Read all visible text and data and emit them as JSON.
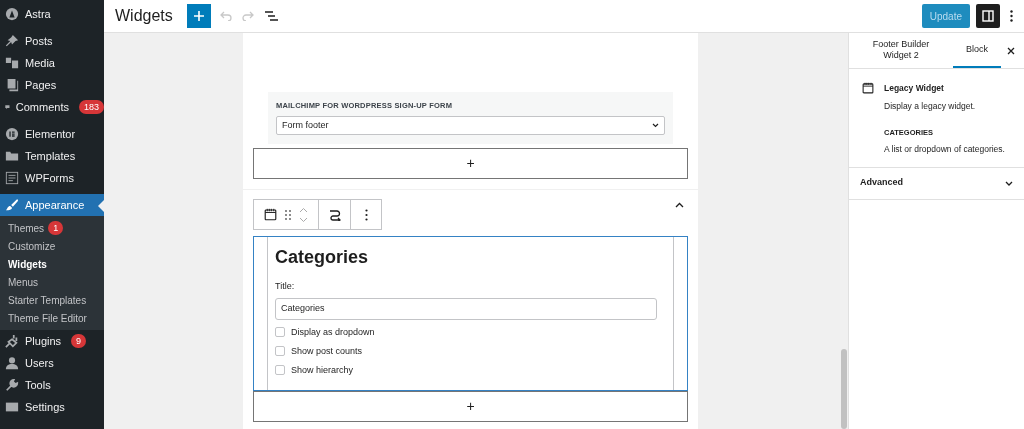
{
  "sidebar": {
    "items": [
      {
        "kind": "menu",
        "label": "Astra",
        "selected": false
      },
      {
        "kind": "gap"
      },
      {
        "kind": "menu",
        "label": "Posts",
        "selected": false
      },
      {
        "kind": "menu",
        "label": "Media",
        "selected": false
      },
      {
        "kind": "menu",
        "label": "Pages",
        "selected": false
      },
      {
        "kind": "menu",
        "label": "Comments",
        "badge": "183",
        "selected": false
      },
      {
        "kind": "gap"
      },
      {
        "kind": "menu",
        "label": "Elementor",
        "selected": false
      },
      {
        "kind": "menu",
        "label": "Templates",
        "selected": false
      },
      {
        "kind": "menu",
        "label": "WPForms",
        "selected": false
      },
      {
        "kind": "gap"
      },
      {
        "kind": "menu",
        "label": "Appearance",
        "selected": true,
        "children": [
          {
            "label": "Themes",
            "badge": "1",
            "selected": false
          },
          {
            "label": "Customize",
            "selected": false
          },
          {
            "label": "Widgets",
            "selected": true
          },
          {
            "label": "Menus",
            "selected": false
          },
          {
            "label": "Starter Templates",
            "selected": false
          },
          {
            "label": "Theme File Editor",
            "selected": false
          }
        ]
      },
      {
        "kind": "menu",
        "label": "Plugins",
        "badge": "9",
        "selected": false
      },
      {
        "kind": "menu",
        "label": "Users",
        "selected": false
      },
      {
        "kind": "menu",
        "label": "Tools",
        "selected": false
      },
      {
        "kind": "menu",
        "label": "Settings",
        "selected": false
      }
    ]
  },
  "header": {
    "title": "Widgets",
    "update_button": "Update",
    "undo_disabled": true,
    "redo_disabled": true
  },
  "canvas": {
    "mailchimp": {
      "label": "MAILCHIMP FOR WORDPRESS SIGN-UP FORM",
      "value": "Form footer"
    },
    "appender": "+",
    "widget": {
      "heading": "Categories",
      "title_label": "Title:",
      "title_value": "Categories",
      "options": [
        {
          "label": "Display as dropdown",
          "checked": false
        },
        {
          "label": "Show post counts",
          "checked": false
        },
        {
          "label": "Show hierarchy",
          "checked": false
        }
      ]
    },
    "appender_bottom": "+"
  },
  "inspector": {
    "tabs": [
      {
        "label": "Footer Builder Widget 2",
        "selected": false
      },
      {
        "label": "Block",
        "selected": true
      }
    ],
    "block_title": "Legacy Widget",
    "block_description": "Display a legacy widget.",
    "category_heading": "CATEGORIES",
    "category_description": "A list or dropdown of categories.",
    "panels": [
      {
        "label": "Advanced",
        "expanded": false
      }
    ]
  }
}
